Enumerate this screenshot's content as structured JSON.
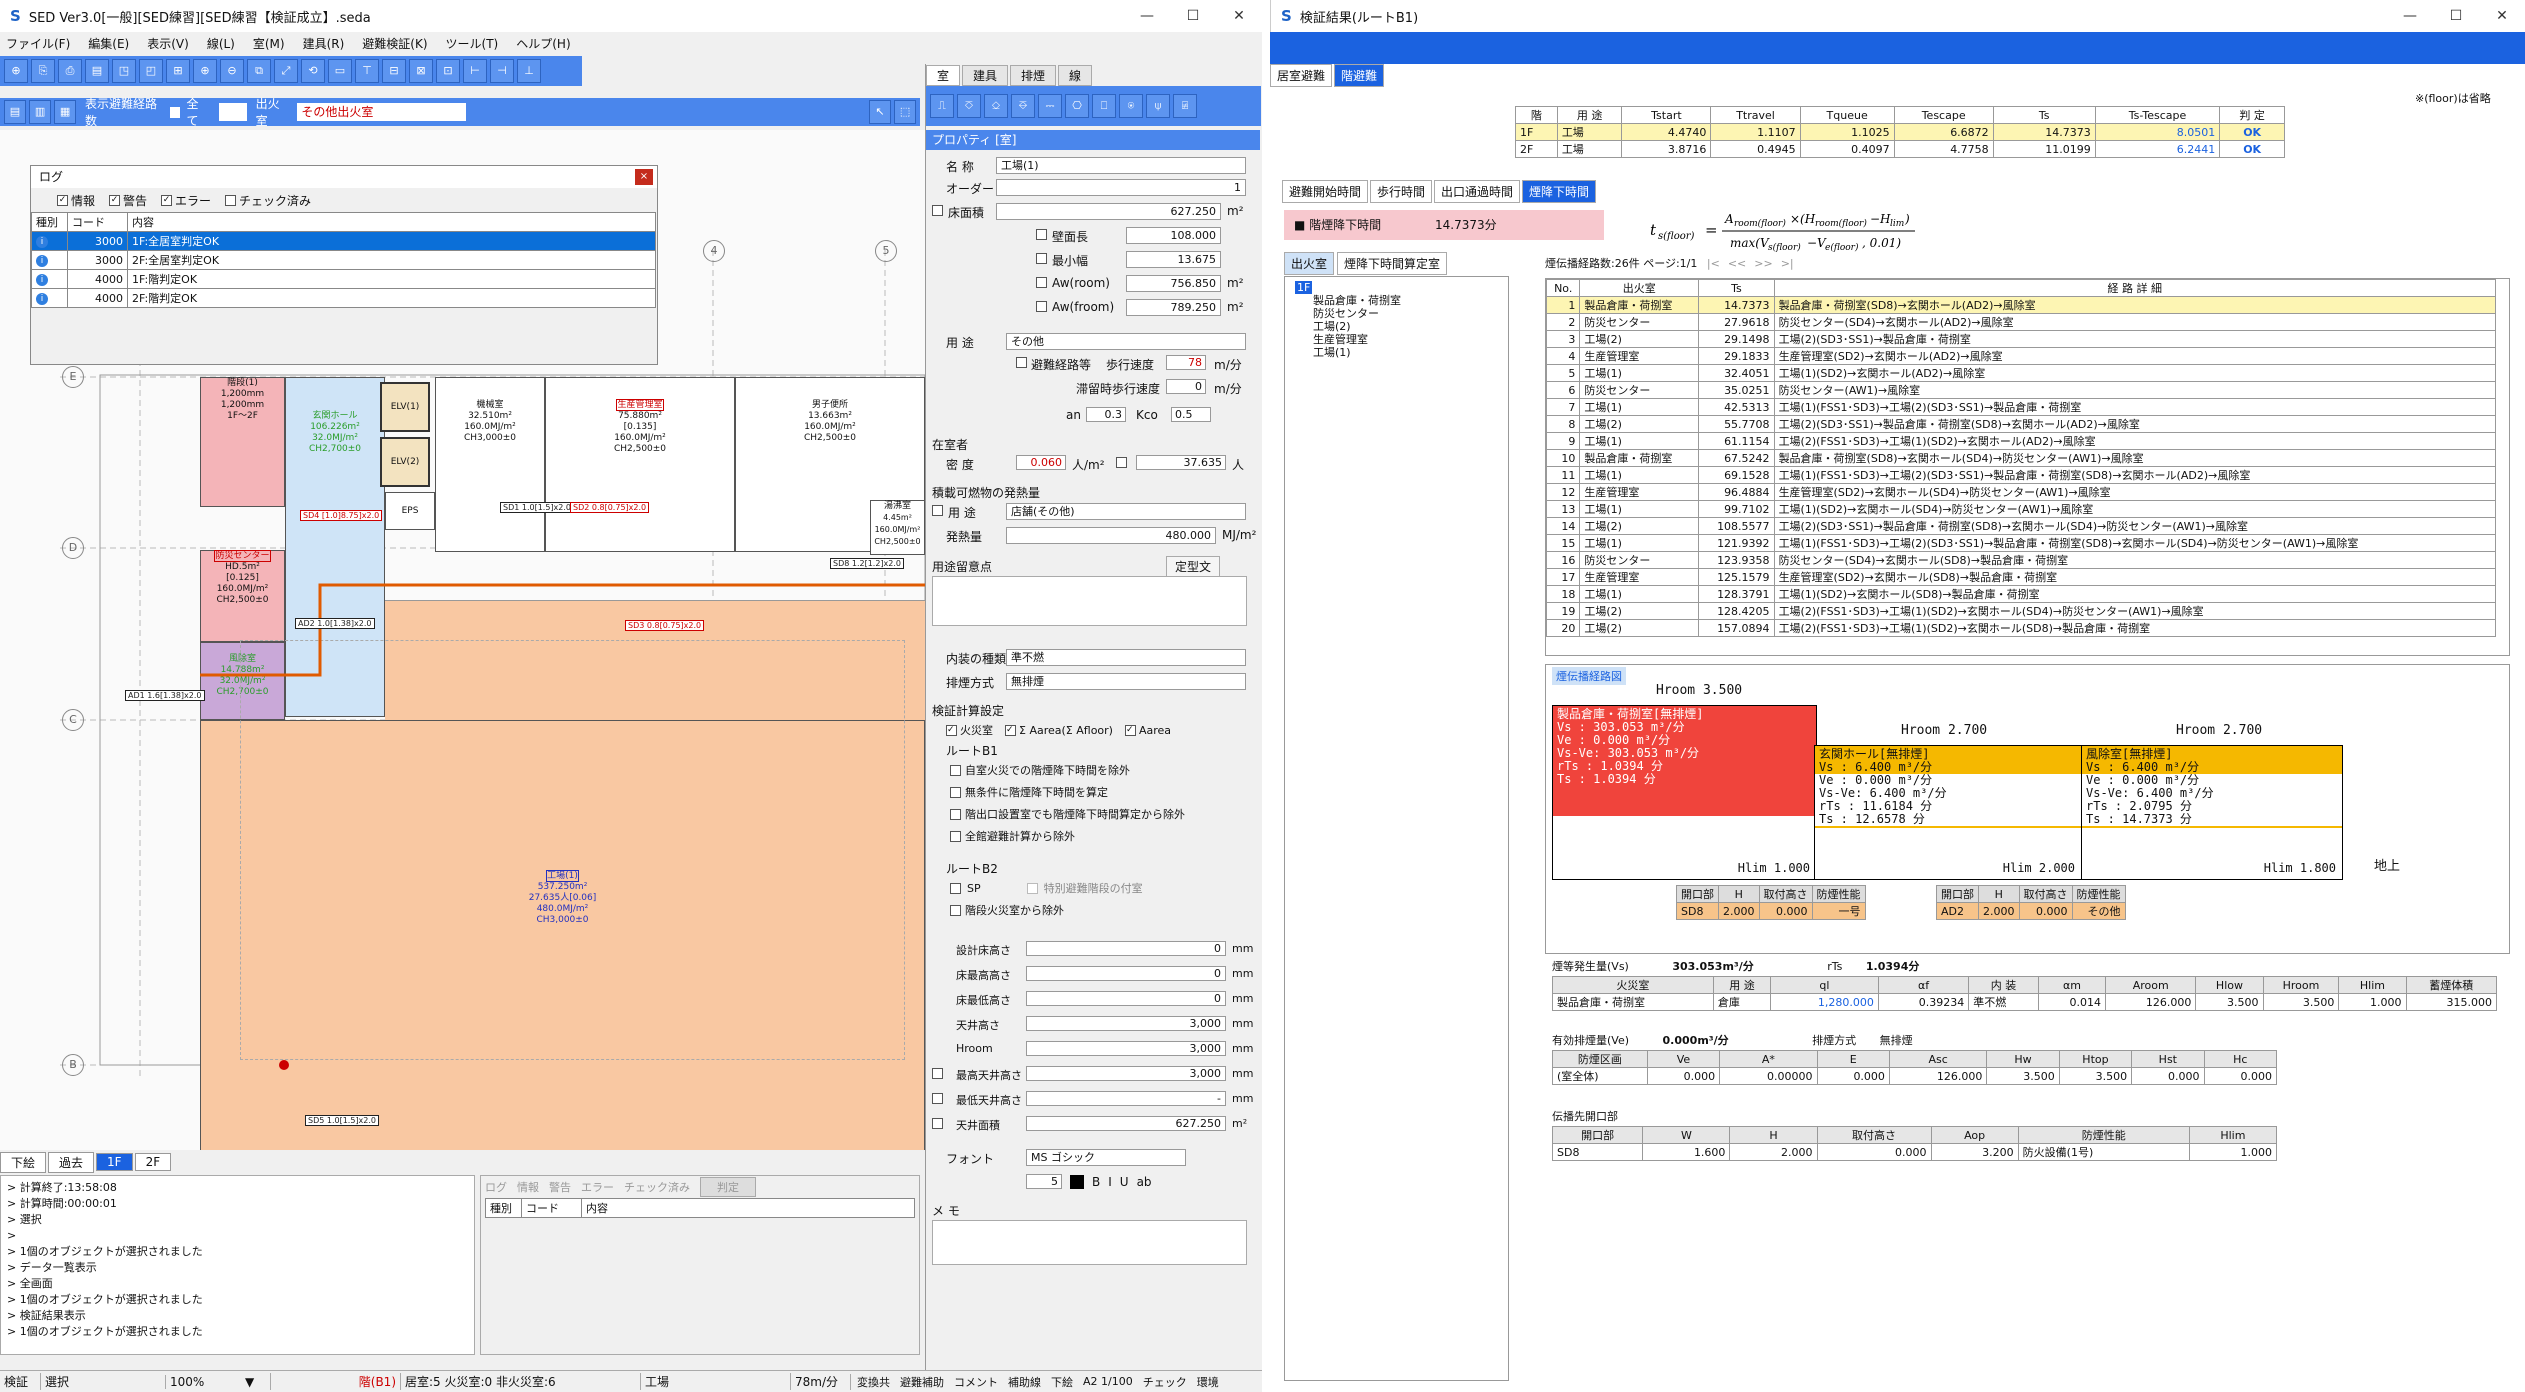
{
  "main_window": {
    "title": "SED Ver3.0[一般][SED練習][SED練習【検証成立】.seda",
    "menus": [
      "ファイル(F)",
      "編集(E)",
      "表示(V)",
      "線(L)",
      "室(M)",
      "建具(R)",
      "避難検証(K)",
      "ツール(T)",
      "ヘルプ(H)"
    ],
    "route_label": "表示避難経路数",
    "all_label": "全て",
    "fire_room_label": "出火室",
    "fire_room_value": "その他出火室",
    "prop_tabs": [
      "室",
      "建具",
      "排煙",
      "線"
    ],
    "grid_labels": [
      "4",
      "5",
      "E",
      "D",
      "C",
      "B"
    ]
  },
  "log": {
    "title": "ログ",
    "filters": [
      "情報",
      "警告",
      "エラー",
      "チェック済み"
    ],
    "headers": [
      "種別",
      "コード",
      "内容"
    ],
    "rows": [
      {
        "code": "3000",
        "text": "1F:全居室判定OK"
      },
      {
        "code": "3000",
        "text": "2F:全居室判定OK"
      },
      {
        "code": "4000",
        "text": "1F:階判定OK"
      },
      {
        "code": "4000",
        "text": "2F:階判定OK"
      }
    ]
  },
  "plan": {
    "rooms": [
      {
        "name": "階段(1)",
        "text": "1,200mm\n1,200mm\n1F～2F"
      },
      {
        "name": "玄関ホール",
        "text": "106.226m²\n32.0MJ/m²\nCH2,700±0"
      },
      {
        "name": "ELV(1)",
        "text": ""
      },
      {
        "name": "ELV(2)",
        "text": ""
      },
      {
        "name": "機械室",
        "text": "32.510m²\n160.0MJ/m²\nCH3,000±0"
      },
      {
        "name": "生産管理室",
        "text": "75.880m²\n[0.135]\n160.0MJ/m²\nCH2,500±0"
      },
      {
        "name": "男子便所",
        "text": "13.663m²\n160.0MJ/m²\nCH2,500±0"
      },
      {
        "name": "防災センター",
        "text": "HD.5m²\n[0.125]\n160.0MJ/m²\nCH2,500±0"
      },
      {
        "name": "風除室",
        "text": "14.788m²\n32.0MJ/m²\nCH2,700±0"
      },
      {
        "name": "工場(1)",
        "text": "537.250m²\n27.635人[0.06]\n480.0MJ/m²\nCH3,000±0"
      },
      {
        "name": "EPS",
        "text": ""
      },
      {
        "name": "湯沸室",
        "text": "4.45m²\n160.0MJ/m²\nCH2,500±0"
      }
    ],
    "tags": [
      "SD4 [1.0]8.75]x2.0",
      "SD1 1.0[1.5]x2.0",
      "SD2 0.8[0.75]x2.0",
      "AD2 1.0[1.38]x2.0",
      "SD3 0.8[0.75]x2.0",
      "SD8 1.2[1.2]x2.0",
      "AD1 1.6[1.38]x2.0",
      "SD5 1.0[1.5]x2.0"
    ]
  },
  "bottom_tabs": [
    "下絵",
    "過去",
    "1F",
    "2F"
  ],
  "console": [
    "> 計算終了:13:58:08",
    "> 計算時間:00:00:01",
    "> 選択",
    "> ",
    "> 1個のオブジェクトが選択されました",
    "> データ一覧表示",
    "> 全画面",
    "> 1個のオブジェクトが選択されました",
    "> 検証結果表示",
    "> 1個のオブジェクトが選択されました"
  ],
  "mini_log": {
    "filters": [
      "ログ",
      "情報",
      "警告",
      "エラー",
      "チェック済み"
    ],
    "button": "判定",
    "headers": [
      "種別",
      "コード",
      "内容"
    ]
  },
  "properties": {
    "title": "プロパティ [室]",
    "name_label": "名 称",
    "name": "工場(1)",
    "order_label": "オーダー",
    "order": "1",
    "floor_area_label": "床面積",
    "floor_area": "627.250",
    "wall_len_label": "壁面長",
    "wall_len": "108.000",
    "min_width_label": "最小幅",
    "min_width": "13.675",
    "aw_room_label": "Aw(room)",
    "aw_room": "756.850",
    "aw_froom_label": "Aw(froom)",
    "aw_froom": "789.250",
    "use_label": "用 途",
    "use": "その他",
    "evac_label": "避難経路等",
    "walk_speed_label": "歩行速度",
    "walk_speed": "78",
    "stay_label": "滞留時歩行速度",
    "stay_speed": "0",
    "unit_mmin": "m/分",
    "an_label": "an",
    "an": "0.3",
    "kco_label": "Kco",
    "kco": "0.5",
    "occupant_label": "在室者",
    "density_label": "密 度",
    "density": "0.060",
    "density_unit": "人/m²",
    "persons": "37.635",
    "persons_unit": "人",
    "heat_label": "積載可燃物の発熱量",
    "heat_use_label": "用 途",
    "heat_use": "店舗(その他)",
    "heat_val_label": "発熱量",
    "heat_val": "480.000",
    "heat_unit": "MJ/m²",
    "notes_label": "用途留意点",
    "template_btn": "定型文",
    "interior_label": "内装の種類",
    "interior": "準不燃",
    "smoke_label": "排煙方式",
    "smoke": "無排煙",
    "calc_label": "検証計算設定",
    "fire_room_chk": "火災室",
    "aarea_chk": "Σ Aarea(Σ Afloor)",
    "aarea2_chk": "Aarea",
    "routeb1": "ルートB1",
    "b1_opts": [
      "自室火災での階煙降下時間を除外",
      "無条件に階煙降下時間を算定",
      "階出口設置室でも階煙降下時間算定から除外",
      "全館避難計算から除外"
    ],
    "routeb2": "ルートB2",
    "sp": "SP",
    "sp2": "特別避難階段の付室",
    "b2_opt": "階段火災室から除外",
    "heights": [
      {
        "label": "設計床高さ",
        "val": "0"
      },
      {
        "label": "床最高高さ",
        "val": "0"
      },
      {
        "label": "床最低高さ",
        "val": "0"
      },
      {
        "label": "天井高さ",
        "val": "3,000"
      },
      {
        "label": "Hroom",
        "val": "3,000"
      },
      {
        "label": "最高天井高さ",
        "val": "3,000"
      },
      {
        "label": "最低天井高さ",
        "val": "-"
      },
      {
        "label": "天井面積",
        "val": "627.250"
      }
    ],
    "mm": "mm",
    "m2": "m²",
    "font_label": "フォント",
    "font": "MS ゴシック",
    "font_size": "5",
    "memo_label": "メ モ"
  },
  "status": {
    "left": "検証",
    "mode": "選択",
    "zoom": "100%",
    "floor": "階(B1)",
    "counts": "居室:5 火災室:0 非火災室:6",
    "room": "工場",
    "speed": "78m/分",
    "right": [
      "変換共",
      "避難補助",
      "コメント",
      "補助線",
      "下絵",
      "A2 1/100",
      "チェック",
      "環境"
    ]
  },
  "result_window": {
    "title": "検証結果(ルートB1)",
    "tabs": [
      "居室避難",
      "階避難"
    ],
    "note": "※(floor)は省略",
    "headers": [
      "階",
      "用 途",
      "Tstart",
      "Ttravel",
      "Tqueue",
      "Tescape",
      "Ts",
      "Ts-Tescape",
      "判 定"
    ],
    "rows": [
      [
        "1F",
        "工場",
        "4.4740",
        "1.1107",
        "1.1025",
        "6.6872",
        "14.7373",
        "8.0501",
        "OK"
      ],
      [
        "2F",
        "工場",
        "3.8716",
        "0.4945",
        "0.4097",
        "4.7758",
        "11.0199",
        "6.2441",
        "OK"
      ]
    ],
    "subtabs": [
      "避難開始時間",
      "歩行時間",
      "出口通過時間",
      "煙降下時間"
    ],
    "smoke_title": "■ 階煙降下時間",
    "smoke_val": "14.7373分",
    "formula": "ts(floor) = Aroom(floor) × (Hroom(floor) − Hlim) / max(Vs(floor) − Ve(floor), 0.01)",
    "left_tabs": [
      "出火室",
      "煙降下時間算定室"
    ],
    "tree": [
      "1F",
      "製品倉庫・荷捌室",
      "防災センター",
      "工場(2)",
      "生産管理室",
      "工場(1)"
    ],
    "route_info": "煙伝播経路数:26件 ページ:1/1",
    "route_nav": [
      "|<",
      "<<",
      ">>",
      ">|"
    ],
    "route_headers": [
      "No.",
      "出火室",
      "Ts",
      "経 路 詳 細"
    ],
    "routes": [
      [
        "1",
        "製品倉庫・荷捌室",
        "14.7373",
        "製品倉庫・荷捌室(SD8)→玄関ホール(AD2)→風除室"
      ],
      [
        "2",
        "防災センター",
        "27.9618",
        "防災センター(SD4)→玄関ホール(AD2)→風除室"
      ],
      [
        "3",
        "工場(2)",
        "29.1498",
        "工場(2)(SD3･SS1)→製品倉庫・荷捌室"
      ],
      [
        "4",
        "生産管理室",
        "29.1833",
        "生産管理室(SD2)→玄関ホール(AD2)→風除室"
      ],
      [
        "5",
        "工場(1)",
        "32.4051",
        "工場(1)(SD2)→玄関ホール(AD2)→風除室"
      ],
      [
        "6",
        "防災センター",
        "35.0251",
        "防災センター(AW1)→風除室"
      ],
      [
        "7",
        "工場(1)",
        "42.5313",
        "工場(1)(FSS1･SD3)→工場(2)(SD3･SS1)→製品倉庫・荷捌室"
      ],
      [
        "8",
        "工場(2)",
        "55.7708",
        "工場(2)(SD3･SS1)→製品倉庫・荷捌室(SD8)→玄関ホール(AD2)→風除室"
      ],
      [
        "9",
        "工場(1)",
        "61.1154",
        "工場(2)(FSS1･SD3)→工場(1)(SD2)→玄関ホール(AD2)→風除室"
      ],
      [
        "10",
        "製品倉庫・荷捌室",
        "67.5242",
        "製品倉庫・荷捌室(SD8)→玄関ホール(SD4)→防災センター(AW1)→風除室"
      ],
      [
        "11",
        "工場(1)",
        "69.1528",
        "工場(1)(FSS1･SD3)→工場(2)(SD3･SS1)→製品倉庫・荷捌室(SD8)→玄関ホール(AD2)→風除室"
      ],
      [
        "12",
        "生産管理室",
        "96.4884",
        "生産管理室(SD2)→玄関ホール(SD4)→防災センター(AW1)→風除室"
      ],
      [
        "13",
        "工場(1)",
        "99.7102",
        "工場(1)(SD2)→玄関ホール(SD4)→防災センター(AW1)→風除室"
      ],
      [
        "14",
        "工場(2)",
        "108.5577",
        "工場(2)(SD3･SS1)→製品倉庫・荷捌室(SD8)→玄関ホール(SD4)→防災センター(AW1)→風除室"
      ],
      [
        "15",
        "工場(1)",
        "121.9392",
        "工場(1)(FSS1･SD3)→工場(2)(SD3･SS1)→製品倉庫・荷捌室(SD8)→玄関ホール(SD4)→防災センター(AW1)→風除室"
      ],
      [
        "16",
        "防災センター",
        "123.9358",
        "防災センター(SD4)→玄関ホール(SD8)→製品倉庫・荷捌室"
      ],
      [
        "17",
        "生産管理室",
        "125.1579",
        "生産管理室(SD2)→玄関ホール(SD8)→製品倉庫・荷捌室"
      ],
      [
        "18",
        "工場(1)",
        "128.3791",
        "工場(1)(SD2)→玄関ホール(SD8)→製品倉庫・荷捌室"
      ],
      [
        "19",
        "工場(2)",
        "128.4205",
        "工場(2)(FSS1･SD3)→工場(1)(SD2)→玄関ホール(SD4)→防災センター(AW1)→風除室"
      ],
      [
        "20",
        "工場(2)",
        "157.0894",
        "工場(2)(FSS1･SD3)→工場(1)(SD2)→玄関ホール(SD8)→製品倉庫・荷捌室"
      ]
    ],
    "diagram_title": "煙伝播経路図",
    "blocks": [
      {
        "hroom": "Hroom 3.500",
        "name": "製品倉庫・荷捌室[無排煙]",
        "vs": "303.053",
        "ve": "0.000",
        "vsve": "303.053",
        "rts": "1.0394",
        "ts": "1.0394",
        "hlim": "Hlim 1.000"
      },
      {
        "hroom": "Hroom 2.700",
        "name": "玄関ホール[無排煙]",
        "vs": "6.400",
        "ve": "0.000",
        "vsve": "6.400",
        "rts": "11.6184",
        "ts": "12.6578",
        "hlim": "Hlim 2.000"
      },
      {
        "hroom": "Hroom 2.700",
        "name": "風除室[無排煙]",
        "vs": "6.400",
        "ve": "0.000",
        "vsve": "6.400",
        "rts": "2.0795",
        "ts": "14.7373",
        "hlim": "Hlim 1.800"
      }
    ],
    "ground": "地上",
    "open_headers": [
      "開口部",
      "H",
      "取付高さ",
      "防煙性能"
    ],
    "open1": [
      "SD8",
      "2.000",
      "0.000",
      "一号"
    ],
    "open2": [
      "AD2",
      "2.000",
      "0.000",
      "その他"
    ],
    "smoke_gen_label": "煙等発生量(Vs)",
    "smoke_gen": "303.053m³/分",
    "rts_label": "rTs",
    "rts": "1.0394分",
    "fire_headers": [
      "火災室",
      "用 途",
      "ql",
      "αf",
      "内 装",
      "αm",
      "Aroom",
      "Hlow",
      "Hroom",
      "Hlim",
      "蓄煙体積"
    ],
    "fire_row": [
      "製品倉庫・荷捌室",
      "倉庫",
      "1,280.000",
      "0.39234",
      "準不燃",
      "0.014",
      "126.000",
      "3.500",
      "3.500",
      "1.000",
      "315.000"
    ],
    "exhaust_label": "有効排煙量(Ve)",
    "exhaust": "0.000m³/分",
    "exhaust_method_label": "排煙方式",
    "exhaust_method": "無排煙",
    "exh_headers": [
      "防煙区画",
      "Ve",
      "A*",
      "E",
      "Asc",
      "Hw",
      "Htop",
      "Hst",
      "Hc"
    ],
    "exh_row": [
      "(室全体)",
      "0.000",
      "0.00000",
      "0.000",
      "126.000",
      "3.500",
      "3.500",
      "0.000",
      "0.000"
    ],
    "prop_label": "伝播先開口部",
    "prop_headers": [
      "開口部",
      "W",
      "H",
      "取付高さ",
      "Aop",
      "防煙性能",
      "Hlim"
    ],
    "prop_row": [
      "SD8",
      "1.600",
      "2.000",
      "0.000",
      "3.200",
      "防火設備(1号)",
      "1.000"
    ]
  },
  "colors": {
    "accent": "#1b62e0",
    "toolbar": "#4a86ec",
    "fire": "#f0443c",
    "orange": "#f5b800",
    "room_orange": "#f9c8a2"
  }
}
